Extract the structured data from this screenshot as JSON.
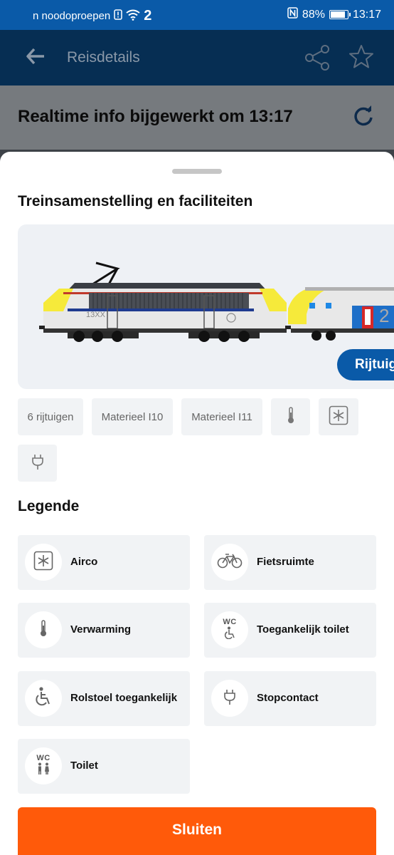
{
  "statusbar": {
    "left_text": "n noodoproepen",
    "sim": "2",
    "battery": "88%",
    "battery_level": 0.88,
    "time": "13:17"
  },
  "appbar": {
    "title": "Reisdetails"
  },
  "realtime": {
    "text": "Realtime info bijgewerkt om 13:17"
  },
  "sheet": {
    "title": "Treinsamenstelling en faciliteiten",
    "train": {
      "loco_number": "13XX",
      "car_label": "2",
      "button_label": "Rijtuig"
    },
    "chips": [
      "6 rijtuigen",
      "Materieel I10",
      "Materieel I11"
    ],
    "chip_icons": [
      "thermometer-icon",
      "snowflake-icon",
      "plug-icon"
    ],
    "legend_title": "Legende",
    "legend": [
      {
        "icon": "snowflake-icon",
        "label": "Airco"
      },
      {
        "icon": "bicycle-icon",
        "label": "Fietsruimte"
      },
      {
        "icon": "thermometer-icon",
        "label": "Verwarming"
      },
      {
        "icon": "accessible-toilet-icon",
        "label": "Toegankelijk toilet",
        "badge": "WC"
      },
      {
        "icon": "wheelchair-icon",
        "label": "Rolstoel toegankelijk"
      },
      {
        "icon": "plug-icon",
        "label": "Stopcontact"
      },
      {
        "icon": "toilet-icon",
        "label": "Toilet",
        "badge": "WC"
      }
    ],
    "close_label": "Sluiten"
  },
  "colors": {
    "brand_blue": "#0a5aa8",
    "dark_navy": "#062e53",
    "close_orange": "#ff5a0a",
    "chip_bg": "#f1f3f5"
  }
}
